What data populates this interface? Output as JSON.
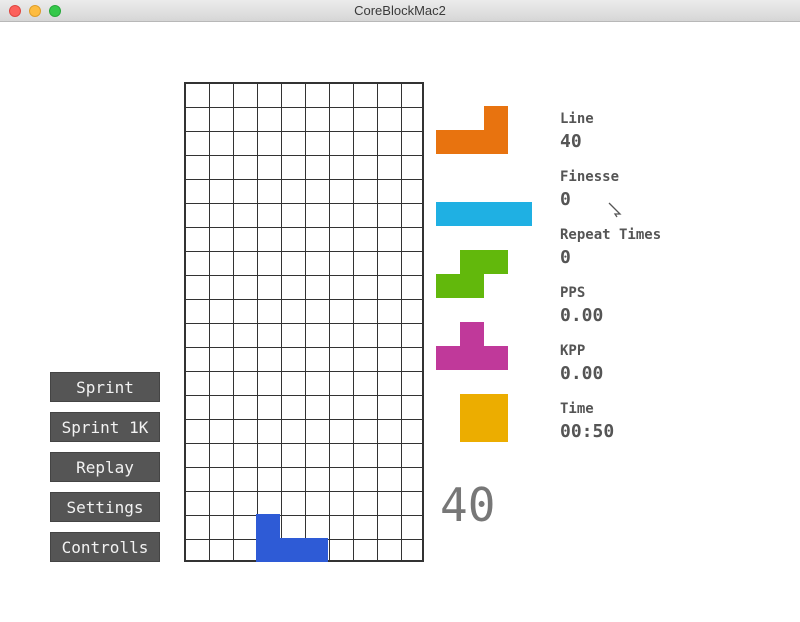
{
  "window": {
    "title": "CoreBlockMac2"
  },
  "menu": {
    "sprint": "Sprint",
    "sprint_1k": "Sprint 1K",
    "replay": "Replay",
    "settings": "Settings",
    "controls": "Controlls"
  },
  "board": {
    "columns": 10,
    "rows": 20,
    "active_piece": {
      "type": "J",
      "color": "#2e5bd6",
      "cells": [
        [
          3,
          18
        ],
        [
          3,
          19
        ],
        [
          4,
          19
        ],
        [
          5,
          19
        ]
      ]
    }
  },
  "next_queue": [
    {
      "type": "L",
      "color": "#e8730f"
    },
    {
      "type": "I",
      "color": "#1fb0e3"
    },
    {
      "type": "S",
      "color": "#62b80c"
    },
    {
      "type": "T",
      "color": "#c0399a"
    },
    {
      "type": "O",
      "color": "#ecad00"
    }
  ],
  "stats": {
    "line_label": "Line",
    "line_value": "40",
    "finesse_label": "Finesse",
    "finesse_value": "0",
    "repeat_label": "Repeat Times",
    "repeat_value": "0",
    "pps_label": "PPS",
    "pps_value": "0.00",
    "kpp_label": "KPP",
    "kpp_value": "0.00",
    "time_label": "Time",
    "time_value": "00:50"
  },
  "lines_remaining": "40"
}
